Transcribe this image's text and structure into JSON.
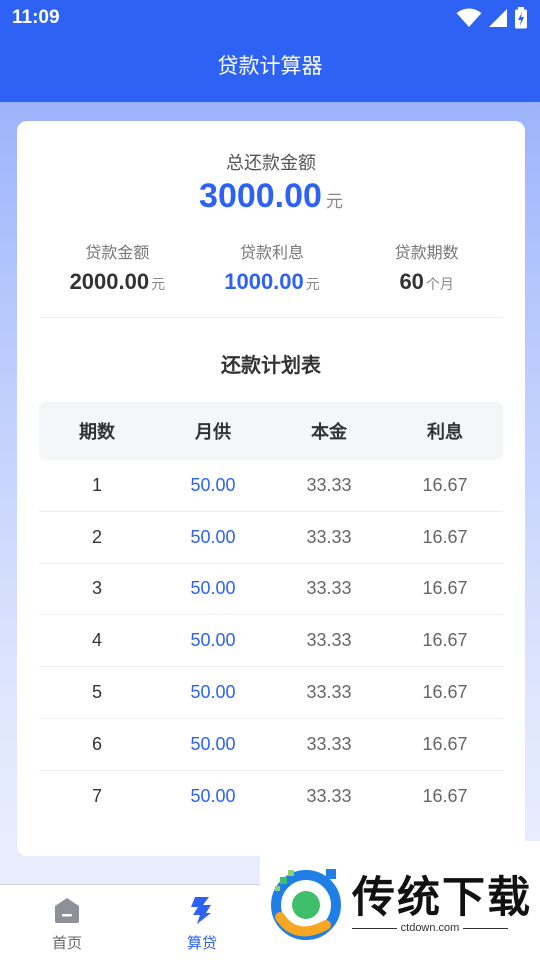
{
  "status_bar": {
    "time": "11:09"
  },
  "header": {
    "title": "贷款计算器"
  },
  "summary": {
    "total_label": "总还款金额",
    "total_value": "3000.00",
    "total_unit": "元",
    "stats": [
      {
        "label": "贷款金额",
        "value": "2000.00",
        "unit": "元"
      },
      {
        "label": "贷款利息",
        "value": "1000.00",
        "unit": "元"
      },
      {
        "label": "贷款期数",
        "value": "60",
        "unit": "个月"
      }
    ]
  },
  "schedule": {
    "title": "还款计划表",
    "columns": [
      "期数",
      "月供",
      "本金",
      "利息"
    ],
    "rows": [
      [
        "1",
        "50.00",
        "33.33",
        "16.67"
      ],
      [
        "2",
        "50.00",
        "33.33",
        "16.67"
      ],
      [
        "3",
        "50.00",
        "33.33",
        "16.67"
      ],
      [
        "4",
        "50.00",
        "33.33",
        "16.67"
      ],
      [
        "5",
        "50.00",
        "33.33",
        "16.67"
      ],
      [
        "6",
        "50.00",
        "33.33",
        "16.67"
      ],
      [
        "7",
        "50.00",
        "33.33",
        "16.67"
      ]
    ]
  },
  "tabbar": {
    "items": [
      {
        "label": "首页",
        "icon": "home-icon",
        "active": false
      },
      {
        "label": "算贷",
        "icon": "calculator-icon",
        "active": true
      }
    ]
  },
  "watermark": {
    "brand": "传统下载",
    "url": "ctdown.com"
  },
  "colors": {
    "accent": "#2d62f5",
    "header_bg": "#2d62f5"
  }
}
